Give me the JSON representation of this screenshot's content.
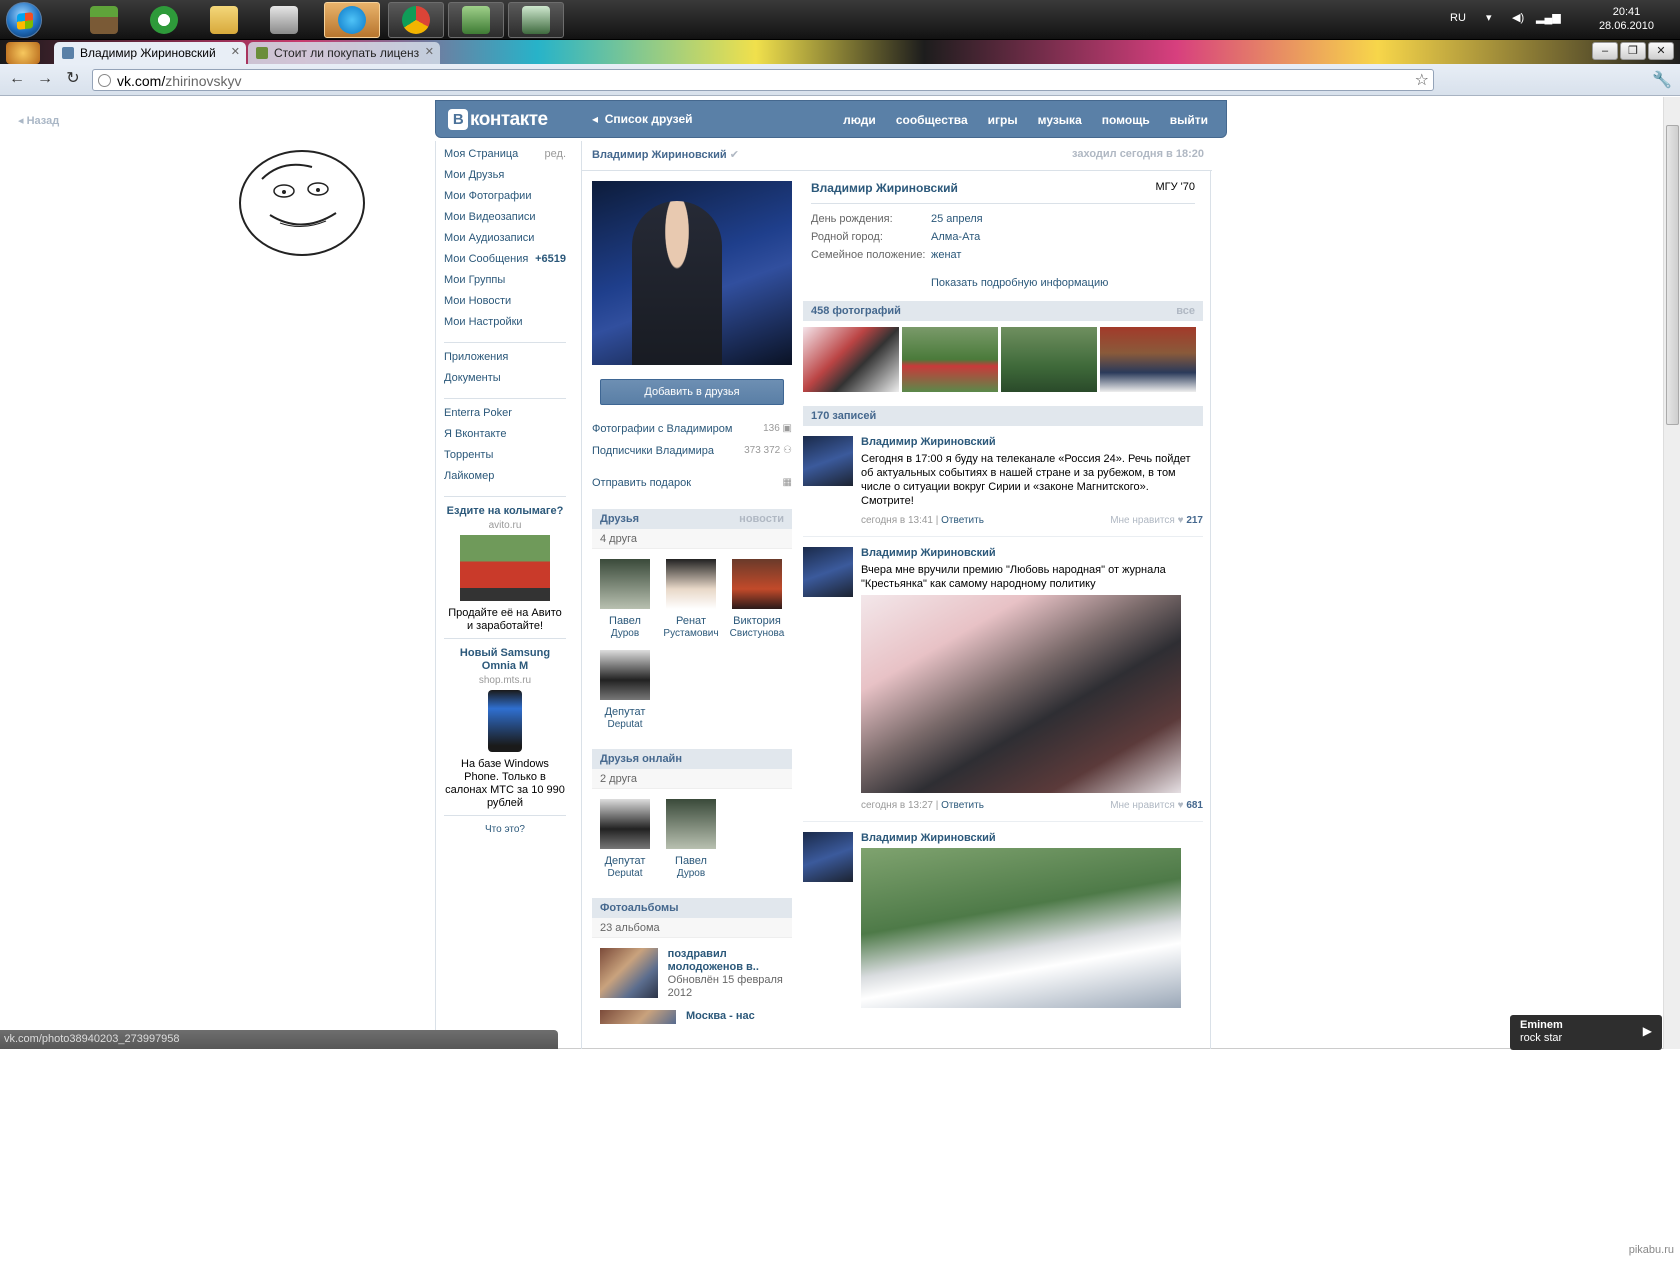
{
  "taskbar": {
    "apps": [
      "minecraft",
      "utorrent",
      "explorer",
      "aimp",
      "skype",
      "chrome",
      "network",
      "monitor"
    ],
    "tray": {
      "lang": "RU",
      "time": "20:41",
      "date": "28.06.2010"
    }
  },
  "browser": {
    "tabs": [
      {
        "title": "Владимир Жириновский"
      },
      {
        "title": "Стоит ли покупать лиценз"
      }
    ],
    "url": "vk.com/zhirinovskyv",
    "url_host": "vk.com/",
    "url_path": "zhirinovskyv",
    "status_url": "vk.com/photo38940203_273997958"
  },
  "side": {
    "back": "Назад"
  },
  "vk": {
    "logo_b": "В",
    "logo_text": "контакте",
    "crumb": "Список друзей",
    "nav": [
      "люди",
      "сообщества",
      "игры",
      "музыка",
      "помощь",
      "выйти"
    ]
  },
  "menu": {
    "items": [
      {
        "label": "Моя Страница",
        "extra": "ред."
      },
      {
        "label": "Мои Друзья"
      },
      {
        "label": "Мои Фотографии"
      },
      {
        "label": "Мои Видеозаписи"
      },
      {
        "label": "Мои Аудиозаписи"
      },
      {
        "label": "Мои Сообщения",
        "extra": "+6519"
      },
      {
        "label": "Мои Группы"
      },
      {
        "label": "Мои Новости"
      },
      {
        "label": "Мои Настройки"
      }
    ],
    "apps": [
      "Приложения",
      "Документы"
    ],
    "custom": [
      "Enterra Poker",
      "Я Вконтакте",
      "Торренты",
      "Лайкомер"
    ],
    "ads": [
      {
        "title": "Ездите на колымаге?",
        "domain": "avito.ru",
        "text": "Продайте её на Авито и заработайте!"
      },
      {
        "title": "Новый Samsung Omnia M",
        "domain": "shop.mts.ru",
        "text": "На базе Windows Phone. Только в салонах МТС за 10 990 рублей"
      }
    ],
    "what": "Что это?"
  },
  "profile": {
    "name": "Владимир Жириновский",
    "seen": "заходил сегодня в 18:20",
    "university": "МГУ '70",
    "add_friend": "Добавить в друзья",
    "links": [
      {
        "label": "Фотографии с Владимиром",
        "count": "136"
      },
      {
        "label": "Подписчики Владимира",
        "count": "373 372"
      }
    ],
    "gift": "Отправить подарок",
    "info": [
      {
        "k": "День рождения:",
        "v": "25 апреля"
      },
      {
        "k": "Родной город:",
        "v": "Алма-Ата"
      },
      {
        "k": "Семейное положение:",
        "v": "женат"
      }
    ],
    "more": "Показать подробную информацию",
    "friends": {
      "title": "Друзья",
      "right": "новости",
      "sub": "4 друга",
      "list": [
        {
          "n1": "Павел",
          "n2": "Дуров"
        },
        {
          "n1": "Ренат",
          "n2": "Рустамович"
        },
        {
          "n1": "Виктория",
          "n2": "Свистунова"
        },
        {
          "n1": "Депутат",
          "n2": "Deputat"
        }
      ]
    },
    "online": {
      "title": "Друзья онлайн",
      "sub": "2 друга",
      "list": [
        {
          "n1": "Депутат",
          "n2": "Deputat"
        },
        {
          "n1": "Павел",
          "n2": "Дуров"
        }
      ]
    },
    "albums": {
      "title": "Фотоальбомы",
      "sub": "23 альбома",
      "list": [
        {
          "t": "поздравил молодоженов в..",
          "d": "Обновлён 15 февраля 2012"
        },
        {
          "t": "Москва - нас"
        }
      ]
    },
    "photos": {
      "title": "458 фотографий",
      "right": "все"
    },
    "wall": {
      "title": "170 записей",
      "posts": [
        {
          "author": "Владимир Жириновский",
          "text": "Сегодня в 17:00 я буду на телеканале «Россия 24». Речь пойдет об актуальных событиях в нашей стране и за рубежом, в том числе о ситуации вокруг Сирии и «законе Магнитского». Смотрите!",
          "time": "сегодня в 13:41",
          "reply": "Ответить",
          "like": "Мне нравится",
          "likes": "217"
        },
        {
          "author": "Владимир Жириновский",
          "text": "Вчера мне вручили премию \"Любовь народная\" от журнала \"Крестьянка\" как самому народному политику",
          "time": "сегодня в 13:27",
          "reply": "Ответить",
          "like": "Мне нравится",
          "likes": "681"
        },
        {
          "author": "Владимир Жириновский",
          "text": ""
        }
      ]
    }
  },
  "player": {
    "artist": "Eminem",
    "track": "rock star"
  },
  "watermark": "pikabu.ru"
}
